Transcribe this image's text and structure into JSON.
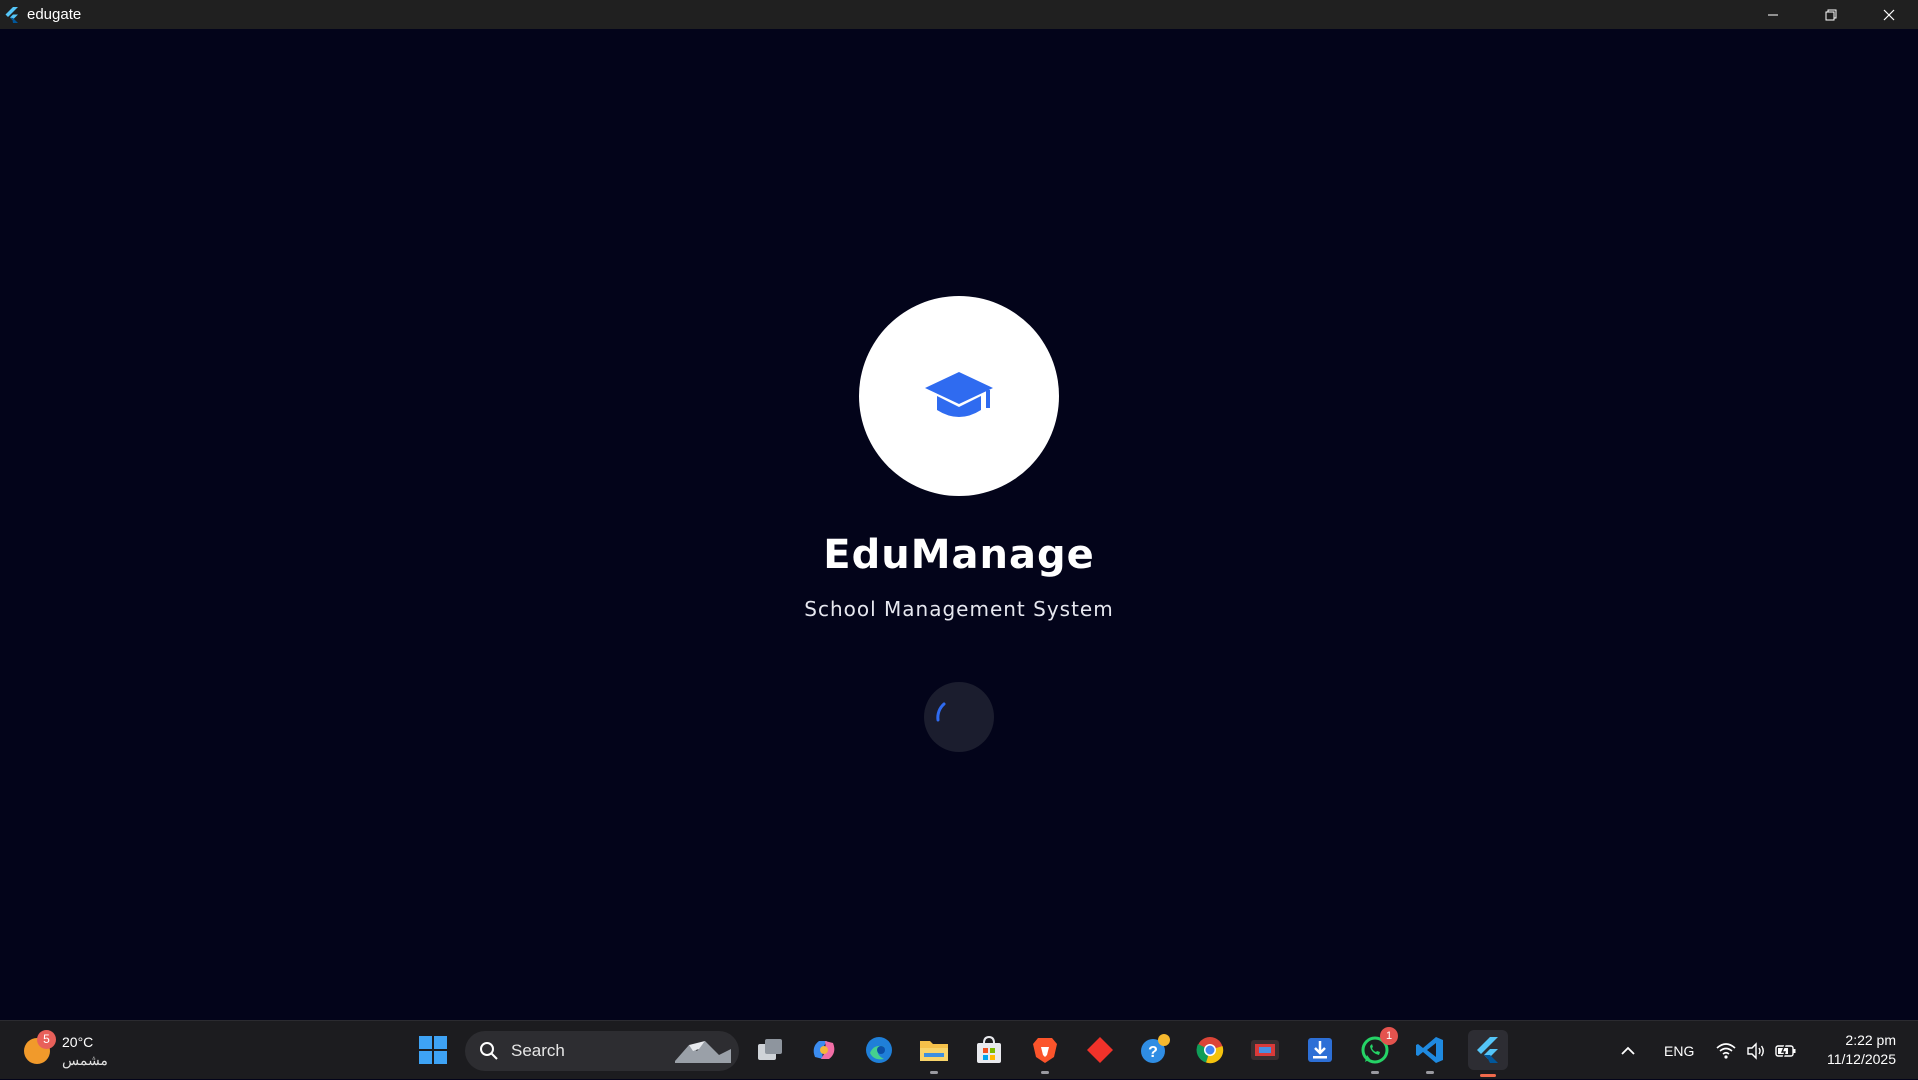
{
  "window": {
    "title": "edugate",
    "controls": [
      "minimize",
      "restore",
      "close"
    ]
  },
  "splash": {
    "logo_icon": "graduation-cap-icon",
    "app_name": "EduManage",
    "subtitle": "School Management System",
    "accent_color": "#2f6bf0",
    "background_color": "#03041a"
  },
  "taskbar": {
    "weather": {
      "temperature": "20°C",
      "condition": "مشمس",
      "badge_count": "5"
    },
    "search": {
      "placeholder": "Search"
    },
    "apps": [
      {
        "name": "start-icon"
      },
      {
        "name": "task-view-icon"
      },
      {
        "name": "copilot-icon"
      },
      {
        "name": "edge-icon"
      },
      {
        "name": "file-explorer-icon"
      },
      {
        "name": "microsoft-store-icon"
      },
      {
        "name": "brave-icon"
      },
      {
        "name": "git-icon"
      },
      {
        "name": "help-icon"
      },
      {
        "name": "chrome-icon"
      },
      {
        "name": "media-player-icon"
      },
      {
        "name": "installer-icon"
      },
      {
        "name": "whatsapp-icon",
        "badge": "1"
      },
      {
        "name": "vscode-icon"
      },
      {
        "name": "flutter-icon"
      }
    ],
    "tray": {
      "language": "ENG",
      "time": "2:22 pm",
      "date": "11/12/2025"
    }
  }
}
